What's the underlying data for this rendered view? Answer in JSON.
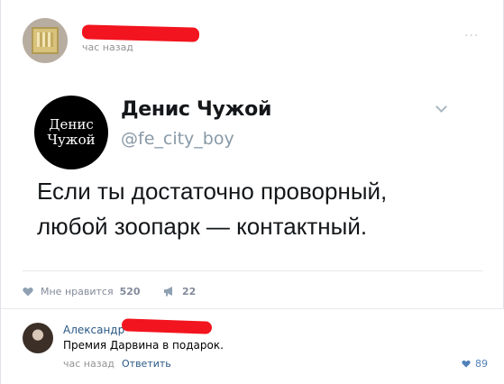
{
  "post": {
    "time": "час назад",
    "more": "..."
  },
  "tweet": {
    "avatar_line1": "Денис",
    "avatar_line2": "Чужой",
    "name": "Денис Чужой",
    "handle": "@fe_city_boy",
    "text_line1": "Если ты достаточно проворный,",
    "text_line2": "любой зоопарк — контактный."
  },
  "actions": {
    "like_label": "Мне нравится",
    "like_count": "520",
    "share_count": "22"
  },
  "comment": {
    "author": "Александр",
    "text": "Премия Дарвина в подарок.",
    "time": "час назад",
    "reply_label": "Ответить",
    "like_count": "89"
  },
  "colors": {
    "link": "#2a5885",
    "muted": "#828a99",
    "like_blue": "#5181b8",
    "redaction": "#f2141e"
  }
}
